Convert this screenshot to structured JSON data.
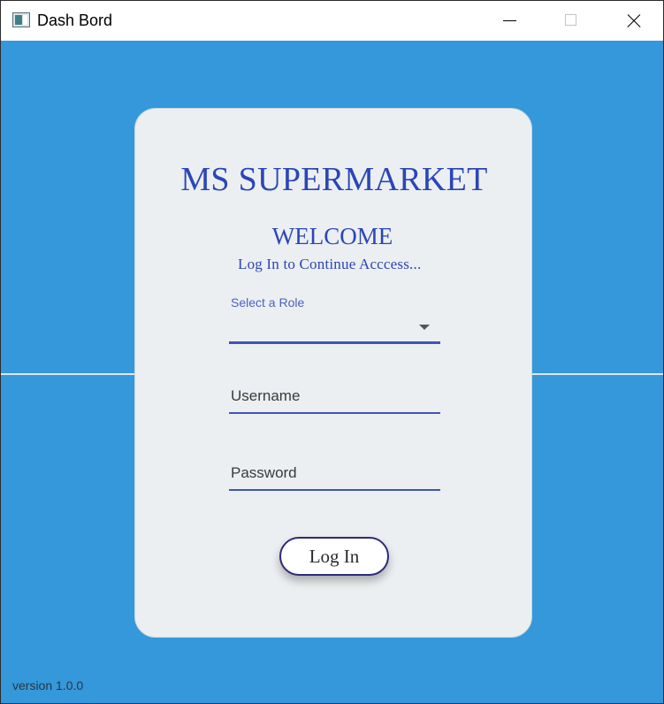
{
  "window": {
    "title": "Dash Bord",
    "icon": "app-window-icon",
    "controls": {
      "minimize_icon": "minimize-icon",
      "maximize_icon": "maximize-icon",
      "close_icon": "close-icon"
    }
  },
  "colors": {
    "background": "#3498db",
    "card": "#eceff1",
    "accent": "#2a46b8",
    "underline": "#3f55b5",
    "button_border": "#2e2a78"
  },
  "login": {
    "brand": "MS SUPERMARKET",
    "welcome": "WELCOME",
    "subtitle": "Log In to Continue Acccess...",
    "role": {
      "label": "Select a Role",
      "value": "",
      "dropdown_icon": "chevron-down-icon"
    },
    "username": {
      "placeholder": "Username",
      "value": ""
    },
    "password": {
      "placeholder": "Password",
      "value": ""
    },
    "button_label": "Log In"
  },
  "footer": {
    "version": "version 1.0.0"
  }
}
